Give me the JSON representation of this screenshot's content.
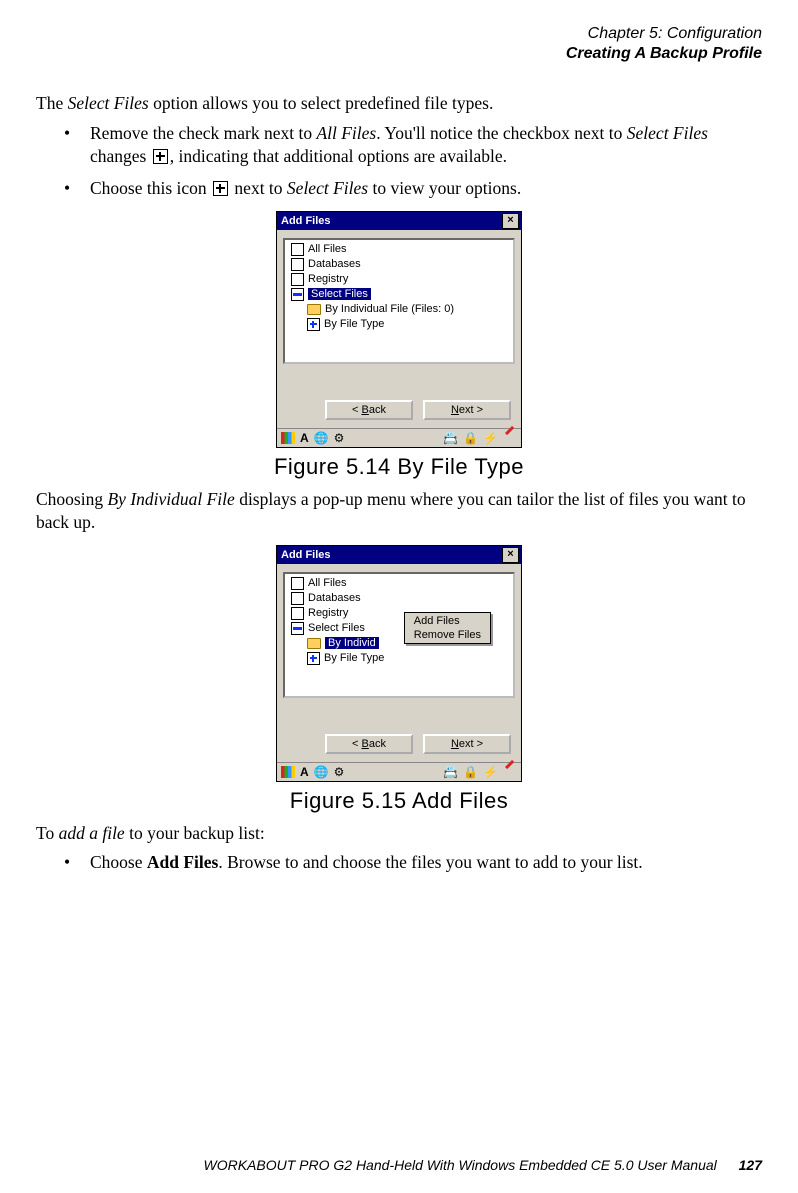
{
  "header": {
    "line1": "Chapter 5: Configuration",
    "line2": "Creating A Backup Profile"
  },
  "p1": {
    "a": "The ",
    "i1": "Select Files",
    "b": " option allows you to select predefined file types."
  },
  "b1": {
    "a": "Remove the check mark next to ",
    "i1": "All Files",
    "b": ". You'll notice the checkbox next to ",
    "i2": "Select Files",
    "c": " changes ",
    "d": ", indicating that additional options are available."
  },
  "b2": {
    "a": "Choose this icon ",
    "b": " next to ",
    "i1": "Select Files",
    "c": " to view your options."
  },
  "dlg": {
    "title": "Add Files",
    "close": "×",
    "items": {
      "all": "All Files",
      "db": "Databases",
      "reg": "Registry",
      "sel": "Select Files",
      "byind": "By Individual File (Files:  0)",
      "byind_short": "By Individ",
      "bytype": "By File Type"
    },
    "back_u": "B",
    "back_rest": "ack",
    "next_u": "N",
    "next_rest": "ext >",
    "popup": {
      "add": "Add Files",
      "remove": "Remove Files"
    }
  },
  "taskbar": {
    "a": "A"
  },
  "cap1": "Figure 5.14 By File Type",
  "p2": {
    "a": "Choosing ",
    "i1": "By Individual File",
    "b": " displays a pop-up menu where you can tailor the list of files you want to back up."
  },
  "cap2": "Figure 5.15 Add Files",
  "p3": {
    "a": "To ",
    "i1": "add a file",
    "b": " to your backup list:"
  },
  "b3": {
    "a": "Choose ",
    "bold": "Add Files",
    "b": ". Browse to and choose the files you want to add to your list."
  },
  "footer": {
    "text": "WORKABOUT PRO G2 Hand-Held With Windows Embedded CE 5.0 User Manual",
    "page": "127"
  }
}
